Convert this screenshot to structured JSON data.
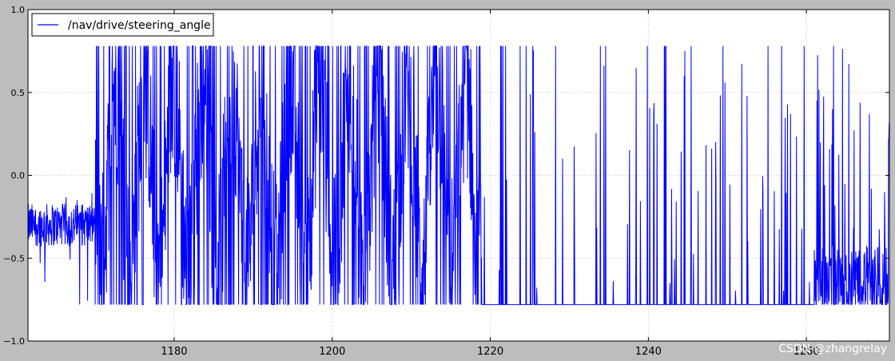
{
  "chart_data": {
    "type": "line",
    "title": "",
    "xlabel": "",
    "ylabel": "",
    "xlim": [
      1161.5,
      1270.5
    ],
    "ylim": [
      -1.0,
      1.0
    ],
    "x_ticks": [
      1180,
      1200,
      1220,
      1240,
      1260
    ],
    "x_tick_labels": [
      "1180",
      "1200",
      "1220",
      "1240",
      "1260"
    ],
    "y_ticks": [
      1.0,
      0.5,
      0.0,
      -0.5,
      -1.0
    ],
    "y_tick_labels": [
      "1.0",
      "0.5",
      "0.0",
      "−0.5",
      "−1.0"
    ],
    "grid": true,
    "grid_style": "dotted",
    "legend_position": "top-left",
    "background_color": "#ffffff",
    "figure_color": "#bdbdbd",
    "series": [
      {
        "name": "/nav/drive/steering_angle",
        "color": "#0000ff",
        "value_range": [
          -0.78,
          0.78
        ],
        "segments": [
          {
            "x_start": 1161.5,
            "x_end": 1170.0,
            "mean": -0.3,
            "spread": 0.13,
            "low": -0.78,
            "high": -0.08,
            "behavior": "noisy band around -0.3"
          },
          {
            "x_start": 1170.0,
            "x_end": 1219.0,
            "low": -0.78,
            "high": 0.78,
            "behavior": "dense oscillation, frequent saturation at ±0.78"
          },
          {
            "x_start": 1219.0,
            "x_end": 1261.0,
            "low": -0.78,
            "high": 0.78,
            "baseline": -0.78,
            "behavior": "mostly saturated at -0.78 with sparse upward spikes"
          },
          {
            "x_start": 1261.0,
            "x_end": 1270.5,
            "low": -0.78,
            "high": 0.78,
            "baseline": -0.78,
            "behavior": "dense noise near -0.6 with many spikes"
          }
        ]
      }
    ]
  },
  "watermark": "CSDN @zhangrelay"
}
